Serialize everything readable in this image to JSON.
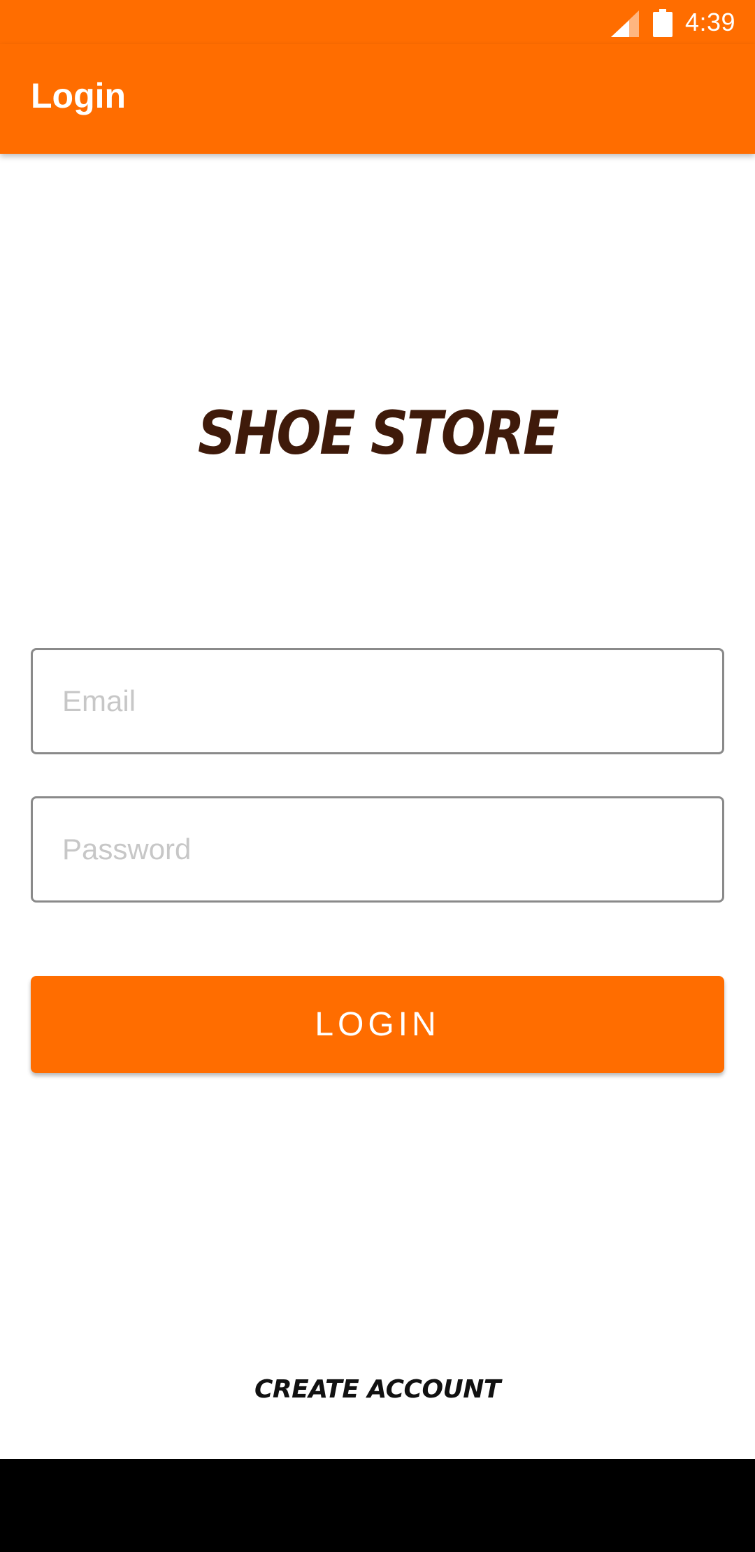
{
  "status_bar": {
    "time": "4:39",
    "signal_icon": "cell-signal-icon",
    "battery_icon": "battery-icon"
  },
  "app_bar": {
    "title": "Login"
  },
  "logo": {
    "text": "SHOE STORE"
  },
  "form": {
    "email": {
      "placeholder": "Email",
      "value": ""
    },
    "password": {
      "placeholder": "Password",
      "value": ""
    },
    "login_label": "LOGIN"
  },
  "create_account_label": "CREATE ACCOUNT",
  "colors": {
    "accent": "#ff6d00",
    "logo": "#3f1a0a",
    "field_border": "#8a8a8a",
    "placeholder": "#c7c7c7"
  }
}
